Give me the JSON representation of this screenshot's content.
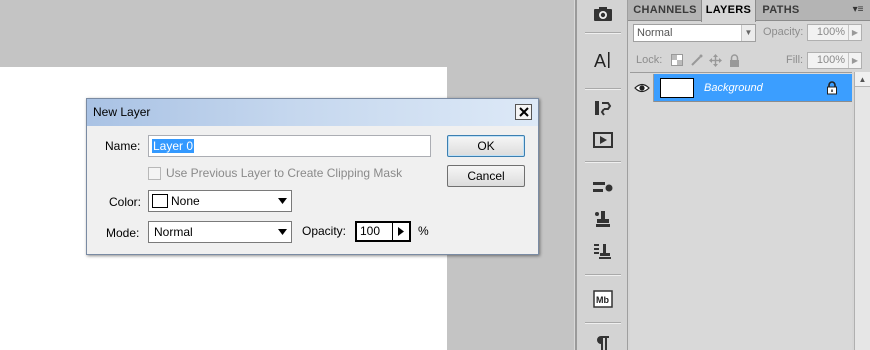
{
  "dialog": {
    "title": "New Layer",
    "name_label": "Name:",
    "name_value": "Layer 0",
    "clip_checkbox_label": "Use Previous Layer to Create Clipping Mask",
    "clip_checked": false,
    "color_label": "Color:",
    "color_value": "None",
    "mode_label": "Mode:",
    "mode_value": "Normal",
    "opacity_label": "Opacity:",
    "opacity_value": "100",
    "opacity_unit": "%",
    "ok_label": "OK",
    "cancel_label": "Cancel"
  },
  "panel": {
    "tabs": [
      {
        "label": "CHANNELS",
        "active": false
      },
      {
        "label": "LAYERS",
        "active": true
      },
      {
        "label": "PATHS",
        "active": false
      }
    ],
    "menu_glyph": "▾≡",
    "blend_mode": "Normal",
    "opacity_label": "Opacity:",
    "opacity_value": "100%",
    "lock_label": "Lock:",
    "fill_label": "Fill:",
    "fill_value": "100%",
    "layers": [
      {
        "name": "Background",
        "visible": true,
        "locked": true,
        "selected": true
      }
    ]
  },
  "dock_icons": [
    "camera-icon",
    "character-icon",
    "history-icon",
    "actions-icon",
    "brush-presets-icon",
    "clone-source-icon",
    "tool-presets-icon",
    "mini-bridge-icon",
    "paragraph-icon"
  ],
  "colors": {
    "selection_blue": "#3b9eff",
    "text_highlight": "#3399ff",
    "workspace_gray": "#c4c4c4",
    "panel_gray": "#d6d6d6"
  }
}
